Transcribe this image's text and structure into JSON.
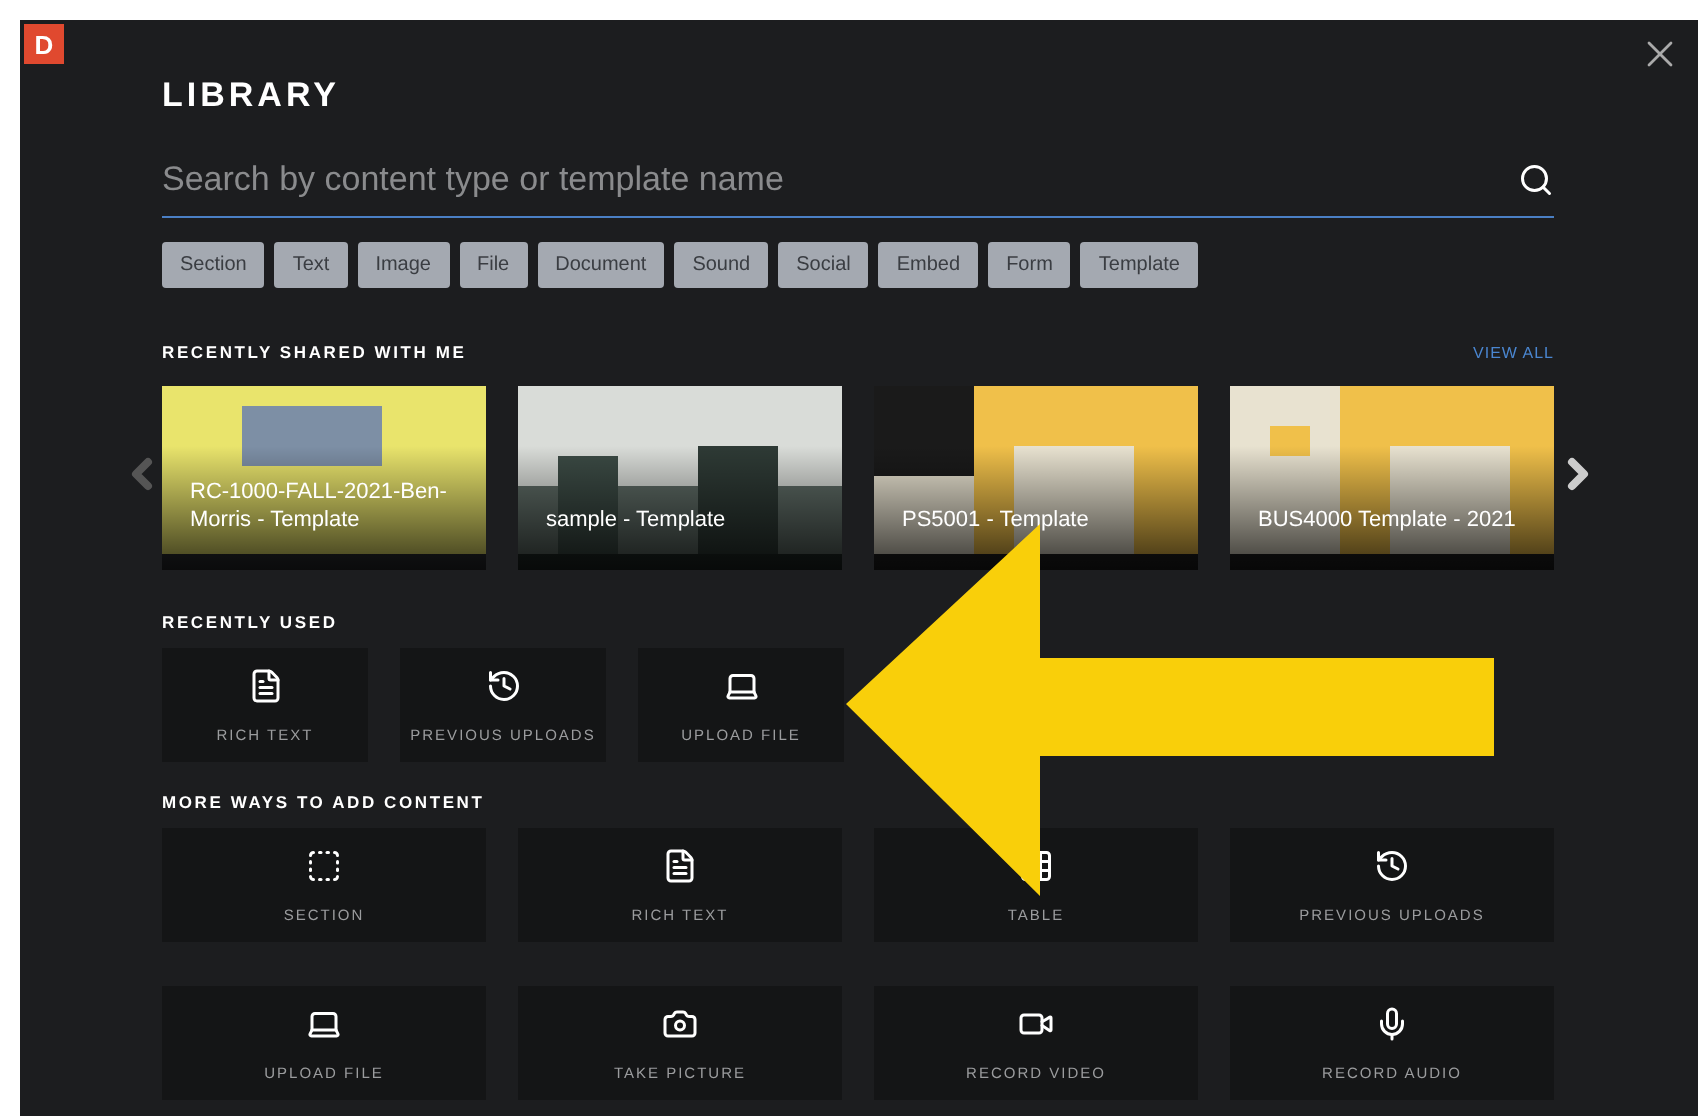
{
  "app_badge": "D",
  "title": "LIBRARY",
  "search": {
    "placeholder": "Search by content type or template name"
  },
  "filters": [
    {
      "label": "Section"
    },
    {
      "label": "Text"
    },
    {
      "label": "Image"
    },
    {
      "label": "File"
    },
    {
      "label": "Document"
    },
    {
      "label": "Sound"
    },
    {
      "label": "Social"
    },
    {
      "label": "Embed"
    },
    {
      "label": "Form"
    },
    {
      "label": "Template"
    }
  ],
  "recently_shared": {
    "heading": "RECENTLY SHARED WITH ME",
    "view_all": "VIEW ALL",
    "templates": [
      {
        "label": "RC-1000-FALL-2021-Ben-Morris - Template",
        "kind": "picture"
      },
      {
        "label": "sample - Template",
        "kind": "picture"
      },
      {
        "label": "PS5001 - Template",
        "kind": "picture"
      },
      {
        "label": "BUS4000 Template - 2021",
        "kind": "picture"
      }
    ]
  },
  "recently_used": {
    "heading": "RECENTLY USED",
    "items": [
      {
        "label": "RICH TEXT"
      },
      {
        "label": "PREVIOUS UPLOADS"
      },
      {
        "label": "UPLOAD FILE"
      }
    ]
  },
  "more_ways": {
    "heading": "MORE WAYS TO ADD CONTENT",
    "items": [
      {
        "label": "SECTION"
      },
      {
        "label": "RICH TEXT"
      },
      {
        "label": "TABLE"
      },
      {
        "label": "PREVIOUS UPLOADS"
      },
      {
        "label": "UPLOAD FILE"
      },
      {
        "label": "TAKE PICTURE"
      },
      {
        "label": "RECORD VIDEO"
      },
      {
        "label": "RECORD AUDIO"
      }
    ]
  }
}
